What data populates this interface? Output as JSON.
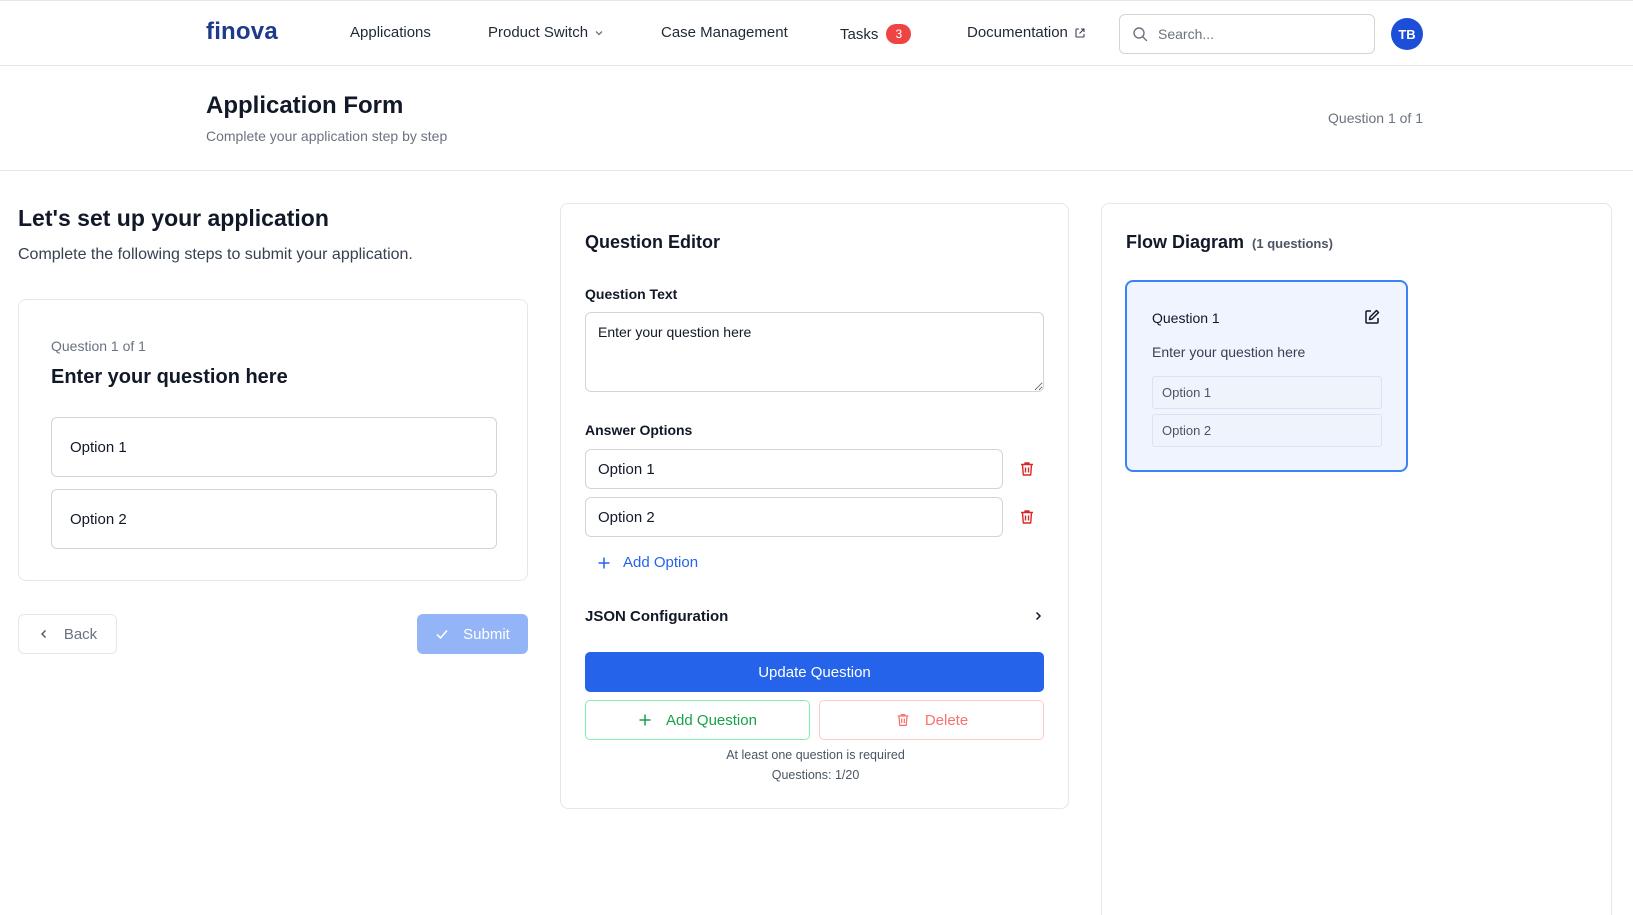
{
  "brand": {
    "logo": "finova",
    "accent": "#2563eb",
    "logo_color": "#1e3a8a"
  },
  "nav": {
    "items": [
      {
        "label": "Applications"
      },
      {
        "label": "Product Switch",
        "icon": "chevron-down-icon"
      },
      {
        "label": "Case Management"
      },
      {
        "label": "Tasks",
        "badge": "3",
        "badge_color": "#ef4444"
      },
      {
        "label": "Documentation",
        "icon": "external-link-icon"
      }
    ],
    "search_placeholder": "Search...",
    "avatar_initials": "TB"
  },
  "page": {
    "title": "Application Form",
    "subtitle": "Complete your application step by step",
    "progress": "Question 1 of 1"
  },
  "preview": {
    "title": "Let's set up your application",
    "subtitle": "Complete the following steps to submit your application.",
    "counter": "Question 1 of 1",
    "question": "Enter your question here",
    "options": [
      "Option 1",
      "Option 2"
    ],
    "back_label": "Back",
    "submit_label": "Submit"
  },
  "editor": {
    "title": "Question Editor",
    "question_text_label": "Question Text",
    "question_text_value": "Enter your question here",
    "answer_options_label": "Answer Options",
    "options": [
      "Option 1",
      "Option 2"
    ],
    "add_option_label": "Add Option",
    "json_config_label": "JSON Configuration",
    "update_label": "Update Question",
    "add_question_label": "Add Question",
    "delete_label": "Delete",
    "note_required": "At least one question is required",
    "note_count": "Questions: 1/20"
  },
  "flow": {
    "title": "Flow Diagram",
    "count": "(1 questions)",
    "node": {
      "title": "Question 1",
      "question": "Enter your question here",
      "options": [
        "Option 1",
        "Option 2"
      ]
    }
  }
}
